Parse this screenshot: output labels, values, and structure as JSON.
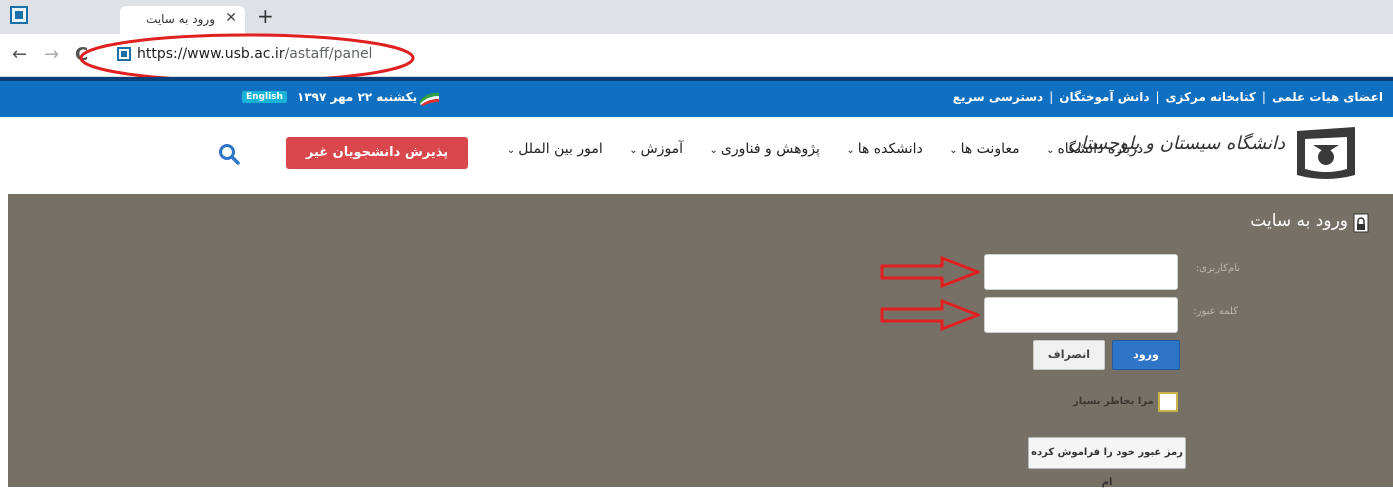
{
  "browser": {
    "tab_title": "ورود به سایت",
    "tab_close": "✕",
    "new_tab": "+",
    "url_host": "https://www.usb.ac.ir",
    "url_path": "/astaff/panel",
    "back": "←",
    "forward": "→",
    "reload": "C"
  },
  "topbar": {
    "links": [
      "اعضای هیات علمی",
      "کتابخانه مرکزی",
      "دانش آموختگان",
      "دسترسی سریع"
    ],
    "separator": "|",
    "date": "یکشنبه ۲۲ مهر ۱۳۹۷",
    "english_label": "English"
  },
  "header": {
    "logo_text": "دانشگاه سیستان و بلوچستان",
    "nav": [
      "درباره دانشگاه",
      "معاونت ها",
      "دانشکده ها",
      "پژوهش و فناوری",
      "آموزش",
      "امور بین الملل"
    ],
    "nav_chevron": "⌄",
    "apply_button": "پذیرش دانشجویان غیر ایرانی"
  },
  "login": {
    "title": "ورود به سایت",
    "username_label": "نام‌کاربری:",
    "password_label": "کلمه عبور:",
    "login_button": "ورود",
    "cancel_button": "انصراف",
    "remember_label": "مرا بخاطر بسپار",
    "forgot_button": "رمز عبور خود را فراموش کرده ام"
  },
  "colors": {
    "topbar": "#0f6fc1",
    "apply_button": "#d9464b",
    "main_bg": "#767067",
    "login_button": "#2e75c7",
    "annotation": "#e02020"
  }
}
